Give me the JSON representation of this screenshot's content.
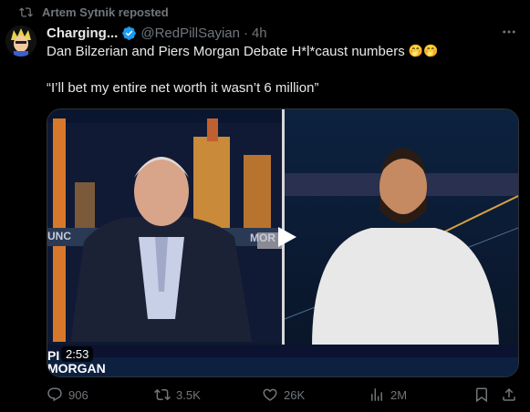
{
  "repost": {
    "text": "Artem Sytnik reposted",
    "icon": "repost-icon"
  },
  "author": {
    "display_name": "Charging...",
    "verified": true,
    "handle": "@RedPillSayian",
    "separator": "·",
    "time": "4h"
  },
  "tweet": {
    "line1": "Dan Bilzerian and Piers Morgan Debate H*l*caust numbers",
    "emoji": "🤭🤭",
    "line2": "“I’ll bet my entire net worth it wasn’t 6 million”"
  },
  "media": {
    "duration": "2:53",
    "left_caption": "PI",
    "left_caption2": "MORGAN",
    "left_sign": "UNC",
    "right_sign": "MOR"
  },
  "actions": {
    "replies": "906",
    "reposts": "3.5K",
    "likes": "26K",
    "views": "2M"
  },
  "colors": {
    "accent": "#1d9bf0",
    "muted": "#71767b",
    "background": "#000000"
  }
}
